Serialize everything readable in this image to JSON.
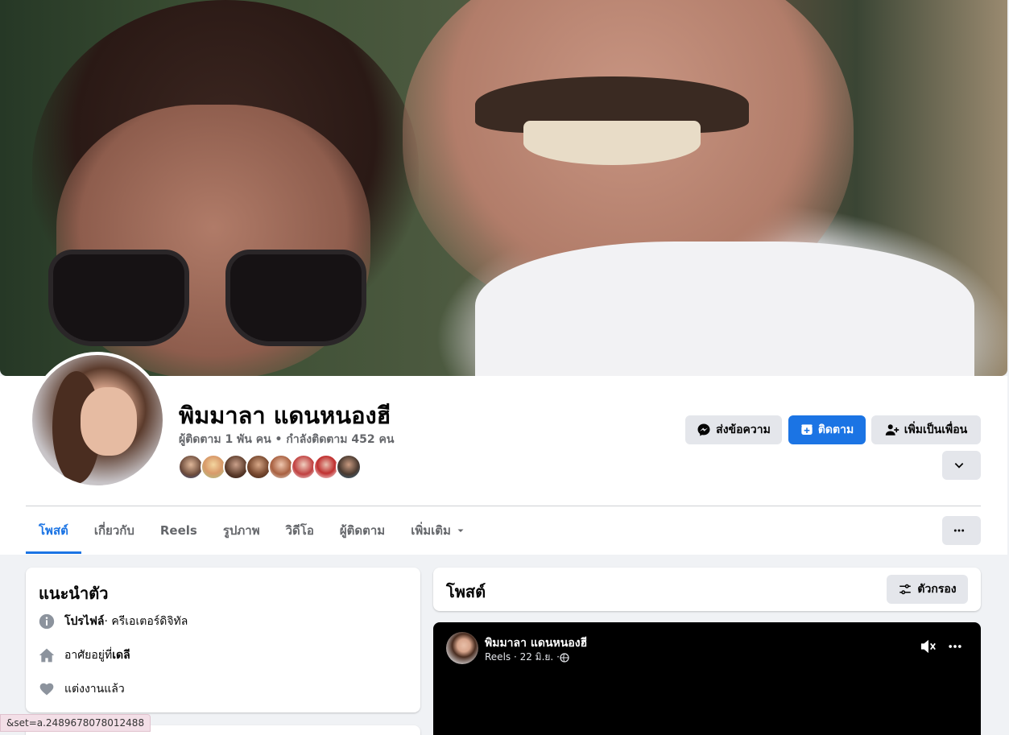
{
  "profile": {
    "name": "พิมมาลา แดนหนองฮี",
    "follow_stats": "ผู้ติดตาม 1 พัน คน • กำลังติดตาม 452 คน"
  },
  "actions": {
    "message_label": "ส่งข้อความ",
    "follow_label": "ติดตาม",
    "add_friend_label": "เพิ่มเป็นเพื่อน"
  },
  "tabs": [
    {
      "label": "โพสต์"
    },
    {
      "label": "เกี่ยวกับ"
    },
    {
      "label": "Reels"
    },
    {
      "label": "รูปภาพ"
    },
    {
      "label": "วิดีโอ"
    },
    {
      "label": "ผู้ติดตาม"
    },
    {
      "label": "เพิ่มเติม"
    }
  ],
  "intro": {
    "title": "แนะนำตัว",
    "profile_label": "โปรไฟล์",
    "profile_value": " · ครีเอเตอร์ดิจิทัล",
    "lives_prefix": "อาศัยอยู่ที่ ",
    "lives_value": "เดลี",
    "relationship": "แต่งงานแล้ว"
  },
  "posts": {
    "title": "โพสต์",
    "filter_label": "ตัวกรอง"
  },
  "reel_post": {
    "author": "พิมมาลา แดนหนองฮี",
    "meta": "Reels · 22 มิ.ย. · "
  },
  "status_bar": {
    "url": "&set=a.2489678078012488"
  },
  "colors": {
    "accent": "#1b74e4",
    "secondary_button": "#e4e6eb",
    "page_bg": "#f0f2f5"
  },
  "icons": [
    "messenger-icon",
    "follow-plus-icon",
    "add-friend-icon",
    "chevron-down-icon",
    "more-icon",
    "info-icon",
    "home-icon",
    "heart-icon",
    "filter-icon",
    "mute-icon",
    "globe-icon"
  ]
}
